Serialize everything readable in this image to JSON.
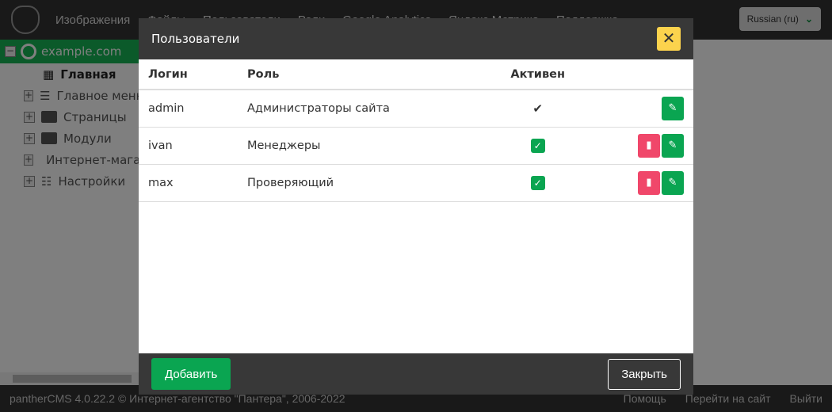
{
  "header": {
    "nav": [
      "Изображения",
      "Файлы",
      "Пользователи",
      "Роли",
      "Google Analytics",
      "Яндекс.Метрика",
      "Поддержка"
    ],
    "language": "Russian (ru)"
  },
  "tree": {
    "root": "example.com",
    "items": [
      "Главная",
      "Главное меню",
      "Страницы",
      "Модули",
      "Интернет-магазин",
      "Настройки"
    ]
  },
  "footer": {
    "copyright": "pantherCMS 4.0.22.2 © Интернет-агентство \"Пантера\", 2006-2022",
    "help": "Помощь",
    "go_site": "Перейти на сайт",
    "logout": "Выйти"
  },
  "modal": {
    "title": "Пользователи",
    "close_icon": "✕",
    "columns": [
      "Логин",
      "Роль",
      "Активен"
    ],
    "rows": [
      {
        "login": "admin",
        "role": "Администраторы сайта",
        "active": true,
        "deletable": false
      },
      {
        "login": "ivan",
        "role": "Менеджеры",
        "active": true,
        "deletable": true
      },
      {
        "login": "max",
        "role": "Проверяющий",
        "active": true,
        "deletable": true
      }
    ],
    "add_label": "Добавить",
    "close_label": "Закрыть"
  },
  "colors": {
    "green": "#0aa551",
    "red": "#f0476a",
    "yellow": "#fcd34d",
    "dark": "#383838"
  }
}
